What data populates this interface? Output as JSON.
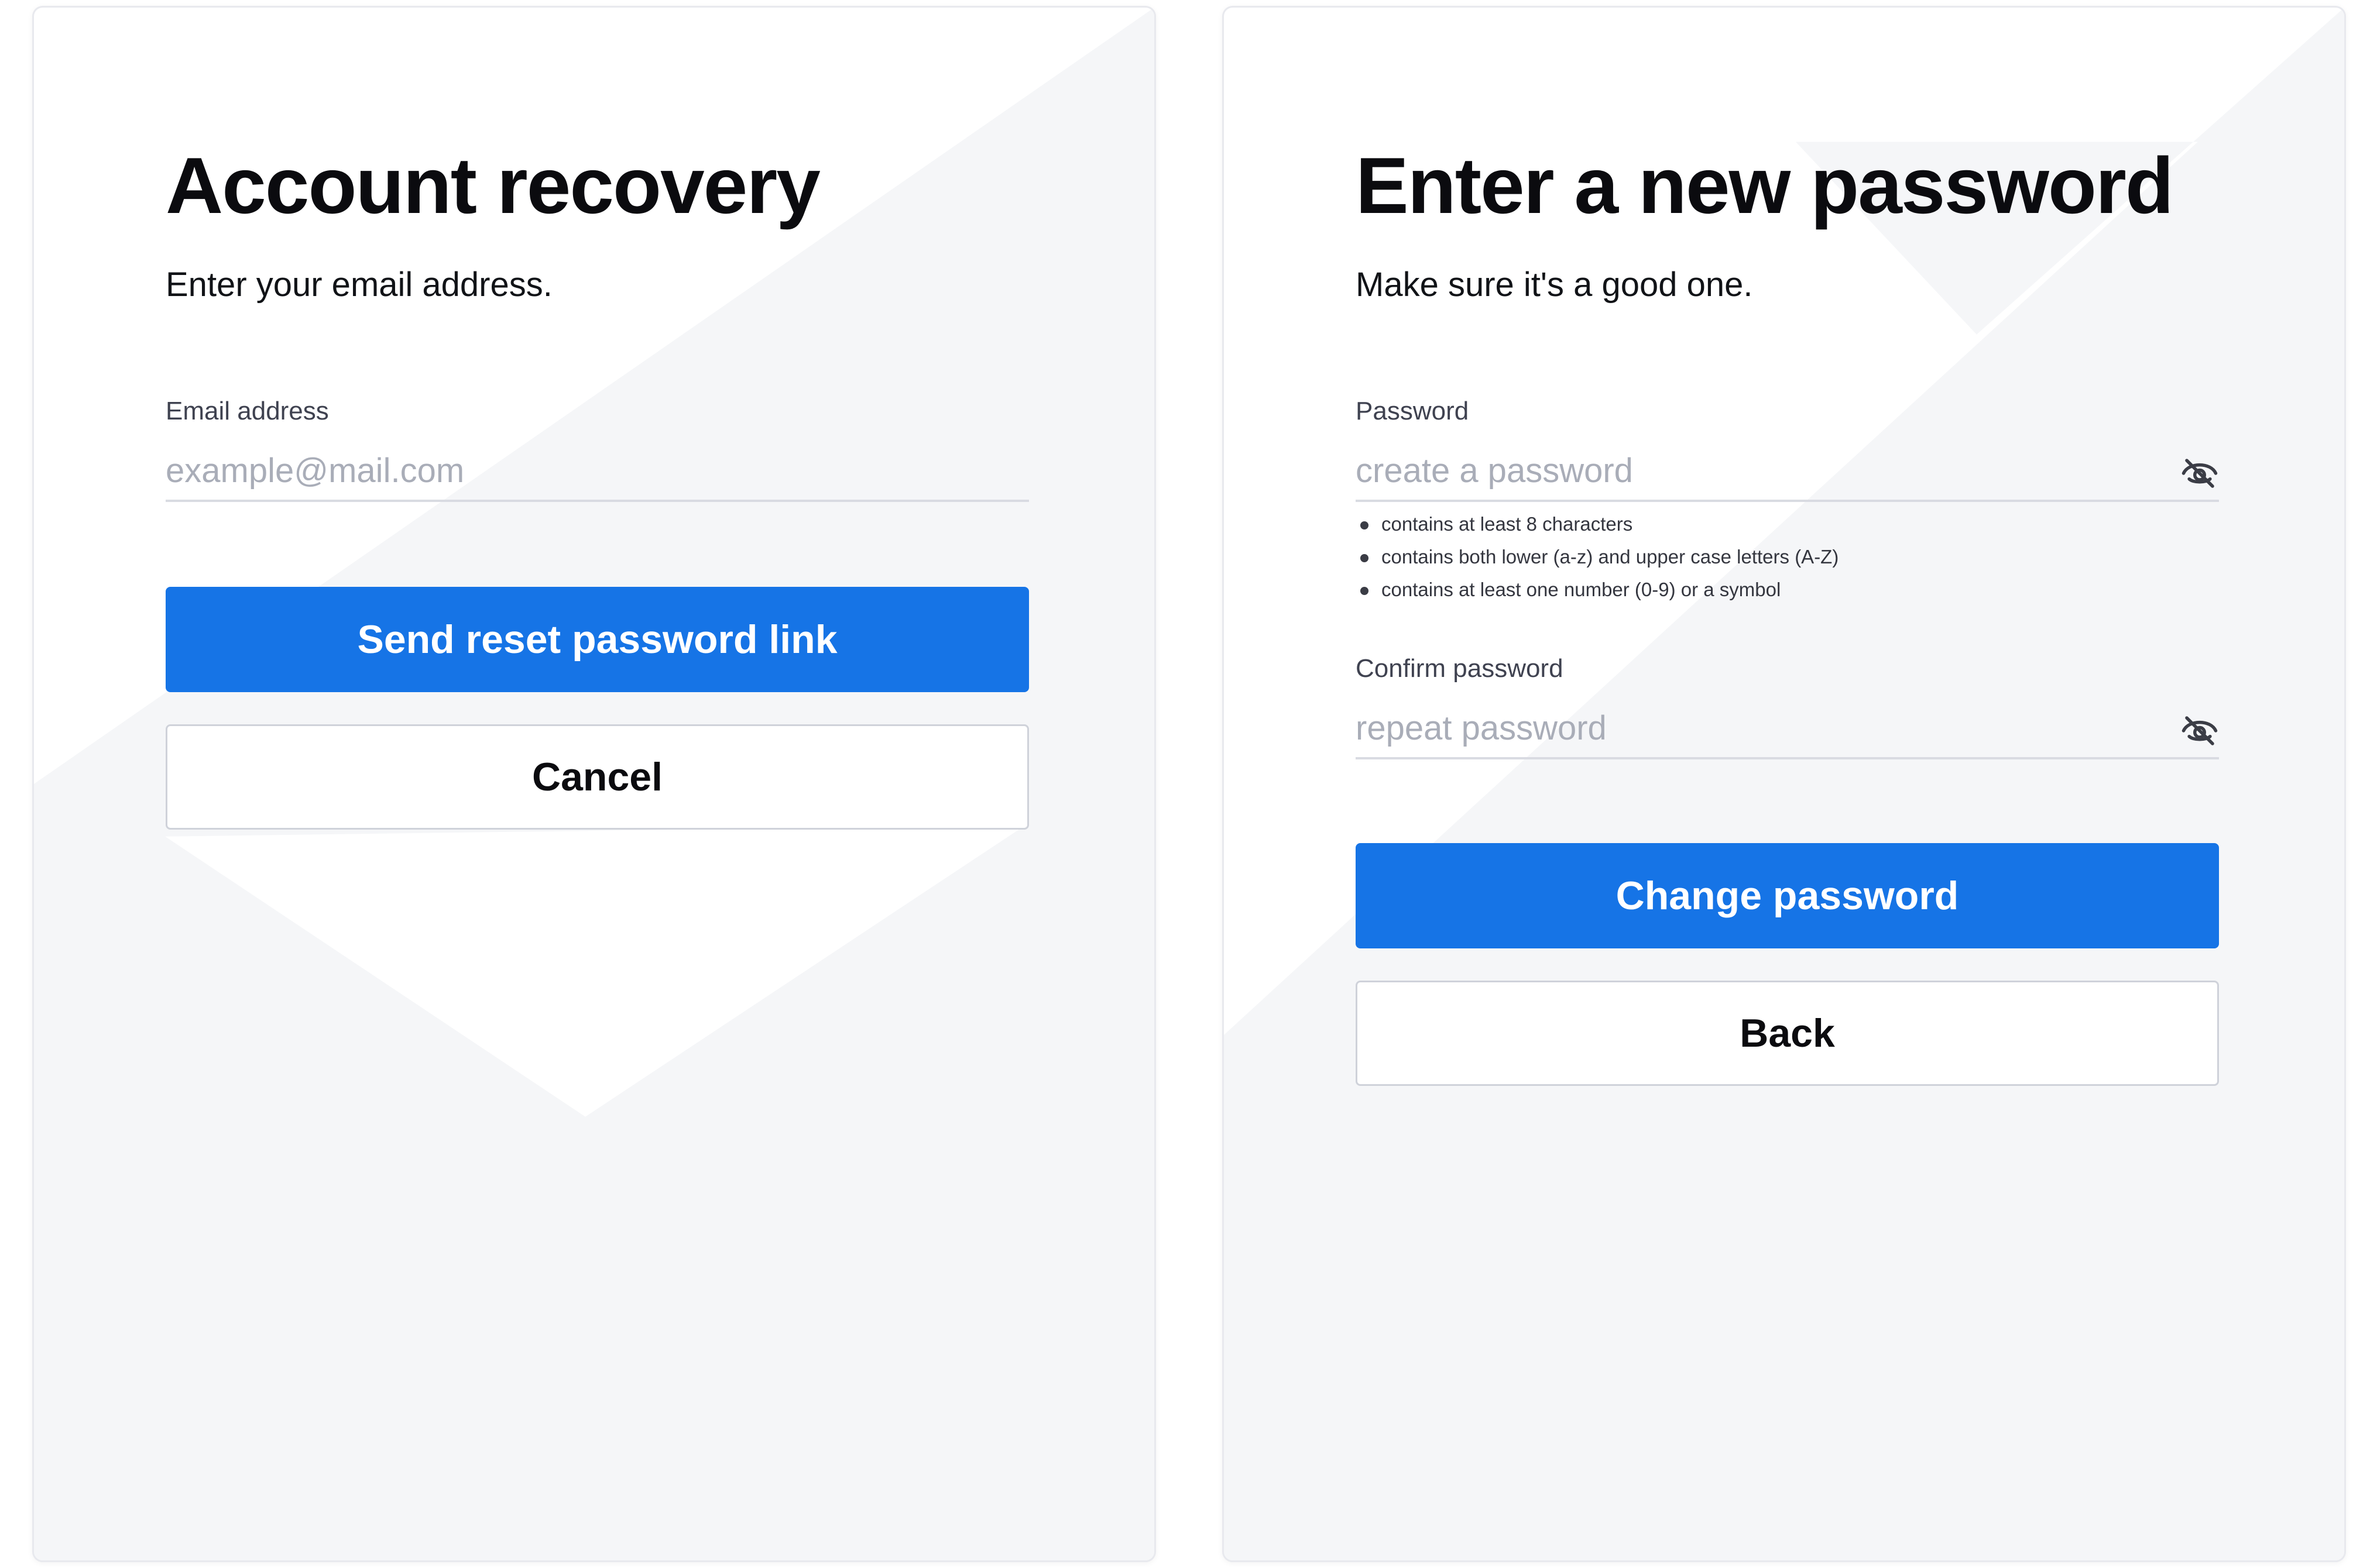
{
  "recovery": {
    "title": "Account recovery",
    "subtitle": "Enter your email address.",
    "email_label": "Email address",
    "email_placeholder": "example@mail.com",
    "email_value": "",
    "submit_label": "Send reset password link",
    "cancel_label": "Cancel"
  },
  "new_password": {
    "title": "Enter a new password",
    "subtitle": "Make sure it's a good one.",
    "password_label": "Password",
    "password_placeholder": "create a password",
    "password_value": "",
    "rules": [
      "contains at least 8 characters",
      "contains both lower (a-z) and upper case letters (A-Z)",
      "contains at least one number (0-9) or a symbol"
    ],
    "confirm_label": "Confirm password",
    "confirm_placeholder": "repeat password",
    "confirm_value": "",
    "submit_label": "Change password",
    "back_label": "Back",
    "visibility_icon": "eye-off-icon"
  },
  "colors": {
    "primary": "#1674e6",
    "background_shape": "#f5f6f8",
    "border": "#cfd2da"
  }
}
